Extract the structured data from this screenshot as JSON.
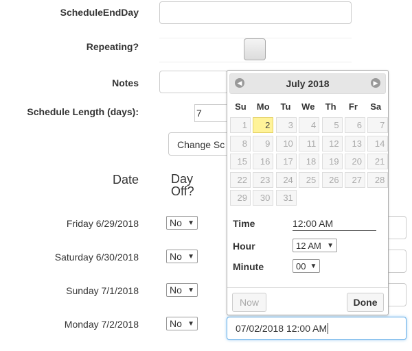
{
  "form": {
    "schedule_end_day_label": "ScheduleEndDay",
    "repeating_label": "Repeating?",
    "notes_label": "Notes",
    "schedule_length_label": "Schedule Length (days):",
    "schedule_length_value": "7",
    "change_button_label": "Change Sc"
  },
  "table": {
    "date_header": "Date",
    "day_off_header_line1": "Day",
    "day_off_header_line2": "Off?",
    "rows": [
      {
        "date": "Friday 6/29/2018",
        "day_off": "No"
      },
      {
        "date": "Saturday 6/30/2018",
        "day_off": "No"
      },
      {
        "date": "Sunday 7/1/2018",
        "day_off": "No"
      },
      {
        "date": "Monday 7/2/2018",
        "day_off": "No"
      }
    ],
    "active_input_value": "07/02/2018 12:00 AM"
  },
  "datepicker": {
    "month_title": "July 2018",
    "prev_icon": "circle-triangle-w-icon",
    "next_icon": "circle-triangle-e-icon",
    "weekdays": [
      "Su",
      "Mo",
      "Tu",
      "We",
      "Th",
      "Fr",
      "Sa"
    ],
    "days": [
      [
        "1",
        "2",
        "3",
        "4",
        "5",
        "6",
        "7"
      ],
      [
        "8",
        "9",
        "10",
        "11",
        "12",
        "13",
        "14"
      ],
      [
        "15",
        "16",
        "17",
        "18",
        "19",
        "20",
        "21"
      ],
      [
        "22",
        "23",
        "24",
        "25",
        "26",
        "27",
        "28"
      ],
      [
        "29",
        "30",
        "31"
      ]
    ],
    "highlighted_day": "2",
    "time_label": "Time",
    "time_value": "12:00 AM",
    "hour_label": "Hour",
    "hour_value": "12 AM",
    "minute_label": "Minute",
    "minute_value": "00",
    "now_button": "Now",
    "done_button": "Done",
    "highlight_color": "#fff399"
  }
}
